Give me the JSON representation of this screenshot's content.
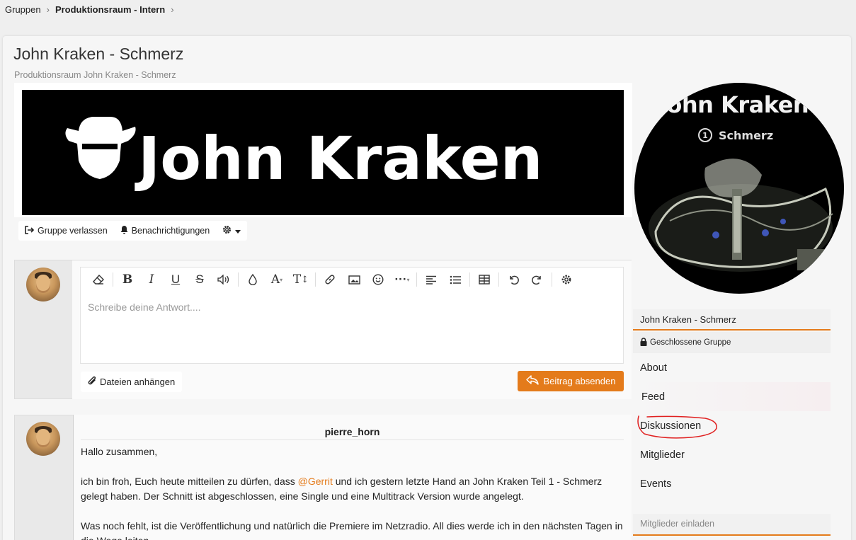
{
  "breadcrumb": {
    "root": "Gruppen",
    "current": "Produktionsraum - Intern"
  },
  "page": {
    "title": "John Kraken - Schmerz",
    "subtitle": "Produktionsraum John Kraken - Schmerz"
  },
  "banner": {
    "logo_text": "John Kraken"
  },
  "actions": {
    "leave": "Gruppe verlassen",
    "notifications": "Benachrichtigungen"
  },
  "editor": {
    "placeholder": "Schreibe deine Antwort....",
    "toolbar_icons": [
      "eraser-icon",
      "bold-icon",
      "italic-icon",
      "underline-icon",
      "strikethrough-icon",
      "volume-icon",
      "color-drop-icon",
      "font-icon",
      "text-size-icon",
      "link-icon",
      "image-icon",
      "smiley-icon",
      "more-icon",
      "align-icon",
      "list-icon",
      "table-icon",
      "undo-icon",
      "redo-icon",
      "settings-icon"
    ],
    "attach_label": "Dateien anhängen",
    "send_label": "Beitrag absenden"
  },
  "post": {
    "author": "pierre_horn",
    "greeting": "Hallo zusammen,",
    "p1_before": "ich bin froh, Euch heute mitteilen zu dürfen, dass ",
    "p1_mention": "@Gerrit",
    "p1_after": " und ich gestern letzte Hand an John Kraken Teil 1 - Schmerz gelegt haben. Der Schnitt ist abgeschlossen, eine Single und eine Multitrack Version wurde angelegt.",
    "p2": "Was noch fehlt, ist die Veröffentlichung und natürlich die Premiere im Netzradio. All dies werde ich in den nächsten Tagen in die Wege leiten."
  },
  "group_avatar": {
    "title": "John Kraken",
    "number": "1",
    "subtitle": "Schmerz"
  },
  "sidebar": {
    "group_name": "John Kraken - Schmerz",
    "status": "Geschlossene Gruppe",
    "nav": [
      {
        "label": "About"
      },
      {
        "label": "Feed"
      },
      {
        "label": "Diskussionen"
      },
      {
        "label": "Mitglieder"
      },
      {
        "label": "Events"
      }
    ],
    "invite": "Mitglieder einladen"
  },
  "colors": {
    "accent": "#e47b1b",
    "annotation": "#e02020"
  }
}
